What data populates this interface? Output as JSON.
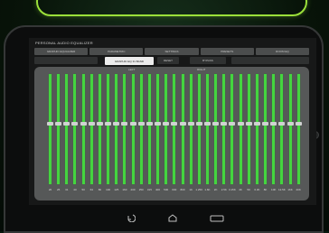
{
  "app": {
    "title": "PERSONAL AUDIO EQUALIZER"
  },
  "tabs": [
    {
      "label": "GRAPHIC EQUALIZER"
    },
    {
      "label": "PARAMETRIC"
    },
    {
      "label": "SETTINGS"
    },
    {
      "label": "PRESETS"
    },
    {
      "label": "ROOM EQ"
    }
  ],
  "subtabs": [
    {
      "label": "GRAPHIC EQ 31 BAND",
      "active": true
    },
    {
      "label": "RESET",
      "active": false
    },
    {
      "label": "BYPASS",
      "active": false
    }
  ],
  "panel": {
    "left_label": "LEFT",
    "right_label": "RIGHT"
  },
  "bands": [
    {
      "label": "20"
    },
    {
      "label": "25"
    },
    {
      "label": "31"
    },
    {
      "label": "40"
    },
    {
      "label": "50"
    },
    {
      "label": "63"
    },
    {
      "label": "80"
    },
    {
      "label": "100"
    },
    {
      "label": "125"
    },
    {
      "label": "160"
    },
    {
      "label": "200"
    },
    {
      "label": "250"
    },
    {
      "label": "315"
    },
    {
      "label": "400"
    },
    {
      "label": "500"
    },
    {
      "label": "630"
    },
    {
      "label": "800"
    },
    {
      "label": "1K"
    },
    {
      "label": "1.25K"
    },
    {
      "label": "1.6K"
    },
    {
      "label": "2K"
    },
    {
      "label": "2.5K"
    },
    {
      "label": "3.15K"
    },
    {
      "label": "4K"
    },
    {
      "label": "5K"
    },
    {
      "label": "6.3K"
    },
    {
      "label": "8K"
    },
    {
      "label": "10K"
    },
    {
      "label": "12.5K"
    },
    {
      "label": "16K"
    },
    {
      "label": "20K"
    }
  ],
  "gain_level": 0.55,
  "colors": {
    "slider_green": "#44d53f",
    "accent_outline": "#9be03a"
  },
  "navbar": {
    "icons": [
      "back-icon",
      "home-icon",
      "recent-apps-icon"
    ]
  }
}
